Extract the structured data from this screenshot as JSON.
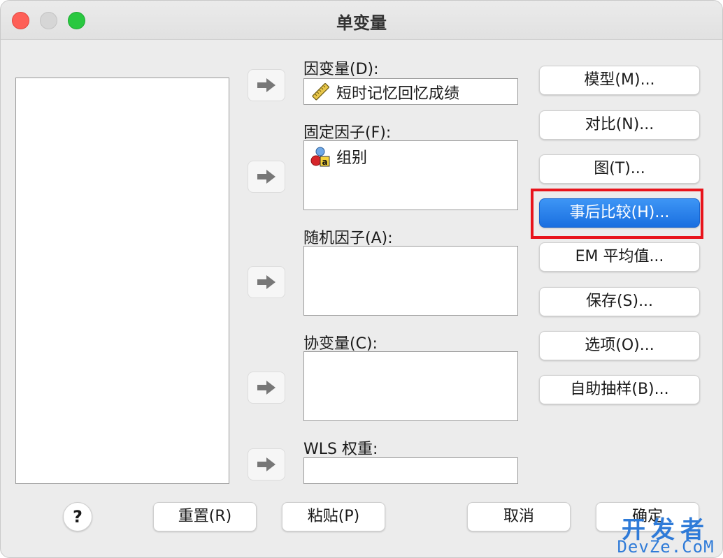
{
  "window": {
    "title": "单变量"
  },
  "fields": {
    "dependent": {
      "label": "因变量(D):",
      "items": [
        "短时记忆回忆成绩"
      ]
    },
    "fixed": {
      "label": "固定因子(F):",
      "items": [
        "组别"
      ]
    },
    "random": {
      "label": "随机因子(A):",
      "items": []
    },
    "covariate": {
      "label": "协变量(C):",
      "items": []
    },
    "wls": {
      "label": "WLS 权重:",
      "items": []
    }
  },
  "side_buttons": {
    "model": "模型(M)...",
    "contrast": "对比(N)...",
    "plots": "图(T)...",
    "posthoc": "事后比较(H)...",
    "emmeans": "EM 平均值...",
    "save": "保存(S)...",
    "options": "选项(O)...",
    "bootstrap": "自助抽样(B)..."
  },
  "bottom_buttons": {
    "help": "?",
    "reset": "重置(R)",
    "paste": "粘贴(P)",
    "cancel": "取消",
    "ok": "确定"
  },
  "watermark": {
    "line1": "开发者",
    "line2": "DevZe.CoM"
  },
  "colors": {
    "highlight": "#e8141c",
    "active_button": "#1a6fe0",
    "watermark": "#2f7bd8"
  },
  "icons": {
    "scale_variable": "ruler-icon",
    "nominal_variable": "nominal-variable-icon",
    "move": "arrow-right-icon"
  }
}
